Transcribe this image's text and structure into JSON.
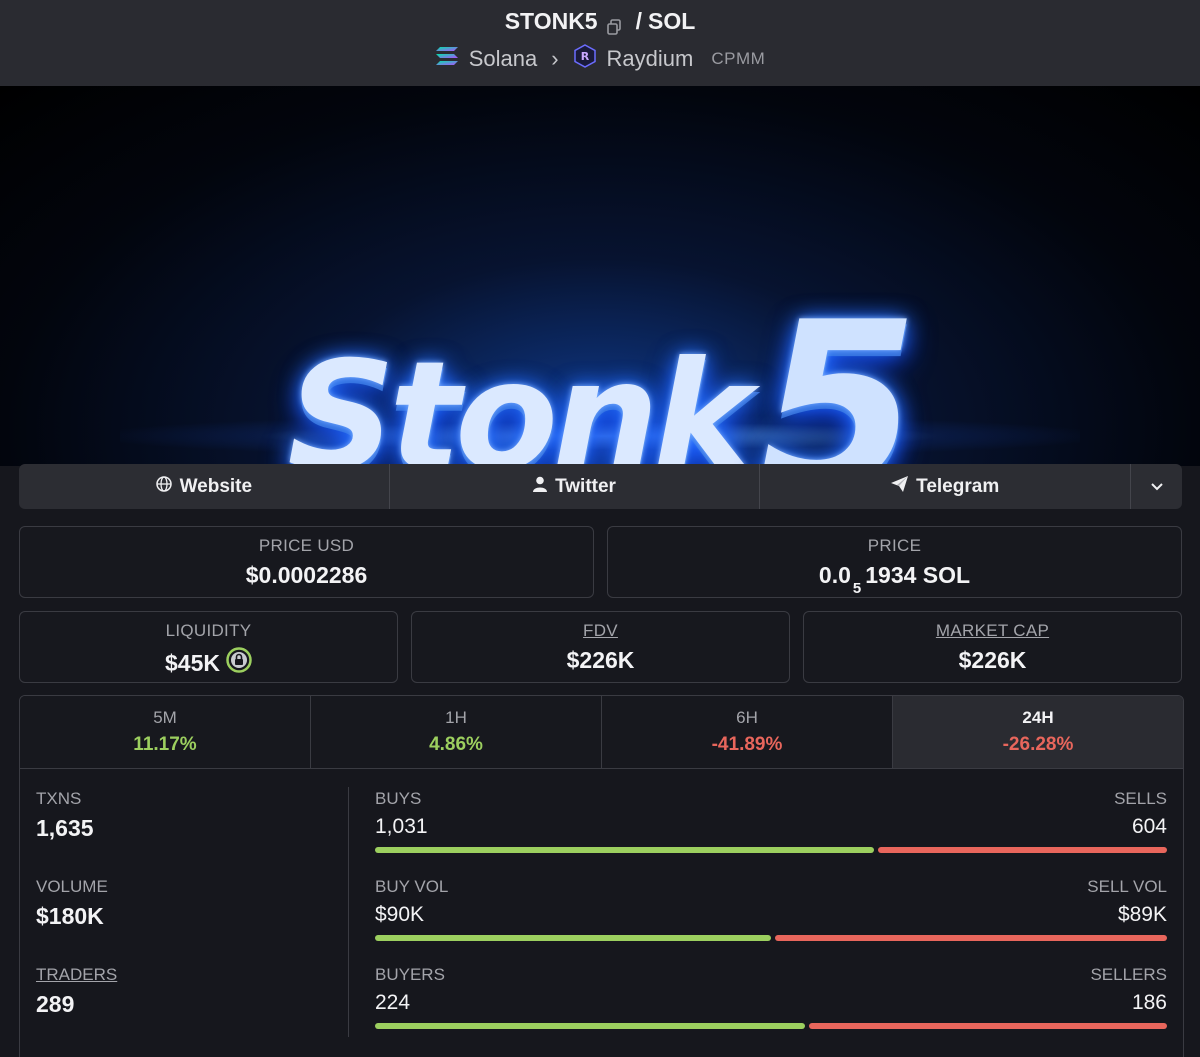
{
  "header": {
    "pair_base": "STONK5",
    "pair_sep": "/",
    "pair_quote": "SOL",
    "chain": "Solana",
    "dex": "Raydium",
    "pool_type": "CPMM"
  },
  "banner": {
    "logo_main": "Stonk",
    "logo_accent": "5"
  },
  "links": {
    "website": "Website",
    "twitter": "Twitter",
    "telegram": "Telegram"
  },
  "price": {
    "usd_label": "PRICE USD",
    "usd_value": "$0.0002286",
    "native_label": "PRICE",
    "native_prefix": "0.0",
    "native_zeros": "5",
    "native_digits": "1934 SOL"
  },
  "metrics": {
    "liquidity_label": "LIQUIDITY",
    "liquidity_value": "$45K",
    "fdv_label": "FDV",
    "fdv_value": "$226K",
    "mcap_label": "MARKET CAP",
    "mcap_value": "$226K"
  },
  "timeframes": [
    {
      "label": "5M",
      "change": "11.17%"
    },
    {
      "label": "1H",
      "change": "4.86%"
    },
    {
      "label": "6H",
      "change": "-41.89%"
    },
    {
      "label": "24H",
      "change": "-26.28%"
    }
  ],
  "stats": {
    "txns_label": "TXNS",
    "txns_value": "1,635",
    "volume_label": "VOLUME",
    "volume_value": "$180K",
    "traders_label": "TRADERS",
    "traders_value": "289",
    "buys_label": "BUYS",
    "buys_value": "1,031",
    "sells_label": "SELLS",
    "sells_value": "604",
    "buy_share": 0.632,
    "buyvol_label": "BUY VOL",
    "buyvol_value": "$90K",
    "sellvol_label": "SELL VOL",
    "sellvol_value": "$89K",
    "buyvol_share": 0.503,
    "buyers_label": "BUYERS",
    "buyers_value": "224",
    "sellers_label": "SELLERS",
    "sellers_value": "186",
    "buyers_share": 0.546
  },
  "colors": {
    "positive": "#9ccf5f",
    "negative": "#e8665c",
    "background": "#16171d"
  }
}
